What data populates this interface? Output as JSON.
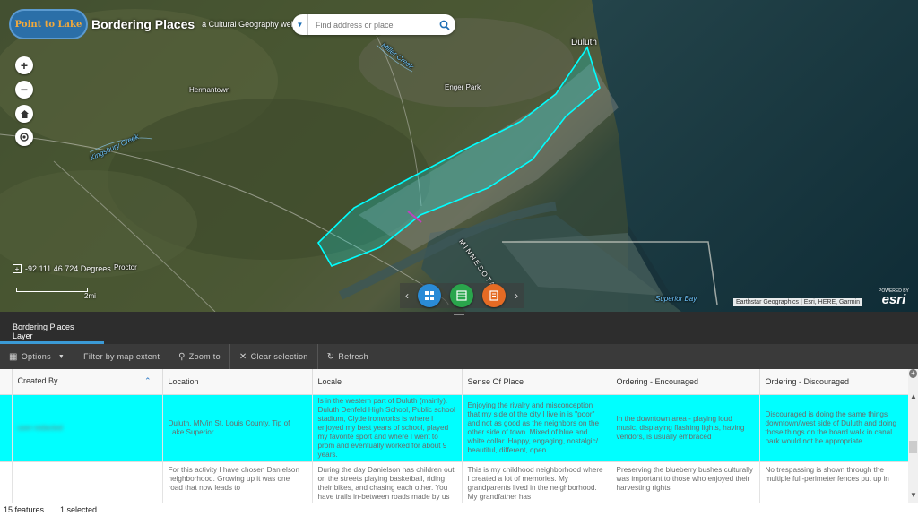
{
  "header": {
    "logo_text": "Point to Lake",
    "title": "Bordering Places",
    "subtitle": "a Cultural Geography web app"
  },
  "search": {
    "placeholder": "Find address or place"
  },
  "map": {
    "labels": {
      "duluth": "Duluth",
      "hermantown": "Hermantown",
      "enger_park": "Enger Park",
      "miller_creek": "Miller Creek",
      "kingsbury_creek": "Kingsbury Creek",
      "proctor": "Proctor",
      "superior_bay": "Superior Bay",
      "minnesota": "MINNESOTA"
    },
    "coordinates": "-92.111 46.724 Degrees",
    "scale": "2mi",
    "attribution": "Earthstar Geographics | Esri, HERE, Garmin",
    "esri_powered": "POWERED BY",
    "esri_name": "esri",
    "highlight_color": "#00ffff"
  },
  "zoom": {
    "in": "+",
    "out": "−"
  },
  "panel": {
    "tab_label": "Bordering Places Layer",
    "toolbar": {
      "options": "Options",
      "filter": "Filter by map extent",
      "zoom_to": "Zoom to",
      "clear_selection": "Clear selection",
      "refresh": "Refresh"
    },
    "columns": [
      "Created By",
      "Location",
      "Locale",
      "Sense Of Place",
      "Ordering - Encouraged",
      "Ordering - Discouraged"
    ],
    "rows": [
      {
        "created_by": "user-redacted",
        "location": "Duluth, MN/in St. Louis County. Tip of Lake Superior",
        "locale": "Is in the western part of Duluth (mainly). Duluth Denfeld High School, Public school stadium, Clyde ironworks is where I enjoyed my best years of school, played my favorite sport and where I went to prom and eventually worked for about 9 years.",
        "sense_of_place": "Enjoying the rivalry and misconception that my side of the city I live in is \"poor\" and not as good as the neighbors on the other side of town. Mixed of blue and white collar. Happy, engaging, nostalgic/ beautiful, different, open.",
        "encouraged": "In the downtown area - playing loud music, displaying flashing lights, having vendors, is usually embraced",
        "discouraged": "Discouraged is doing the same things downtown/west side of Duluth and doing those things on the board walk in canal park would not be appropriate"
      },
      {
        "created_by": "",
        "location": "For this activity I have chosen Danielson neighborhood. Growing up it was one road that now leads to",
        "locale": "During the day Danielson has children out on the streets playing basketball, riding their bikes, and chasing each other. You have trails in-between roads made by us growing up that",
        "sense_of_place": "This is my childhood neighborhood where I created a lot of memories. My grandparents lived in the neighborhood. My grandfather has",
        "encouraged": "Preserving the blueberry bushes culturally was important to those who enjoyed their harvesting rights",
        "discouraged": "No trespassing is shown through the multiple full-perimeter fences put up in"
      }
    ],
    "status": {
      "features": "15 features",
      "selected": "1 selected"
    }
  }
}
